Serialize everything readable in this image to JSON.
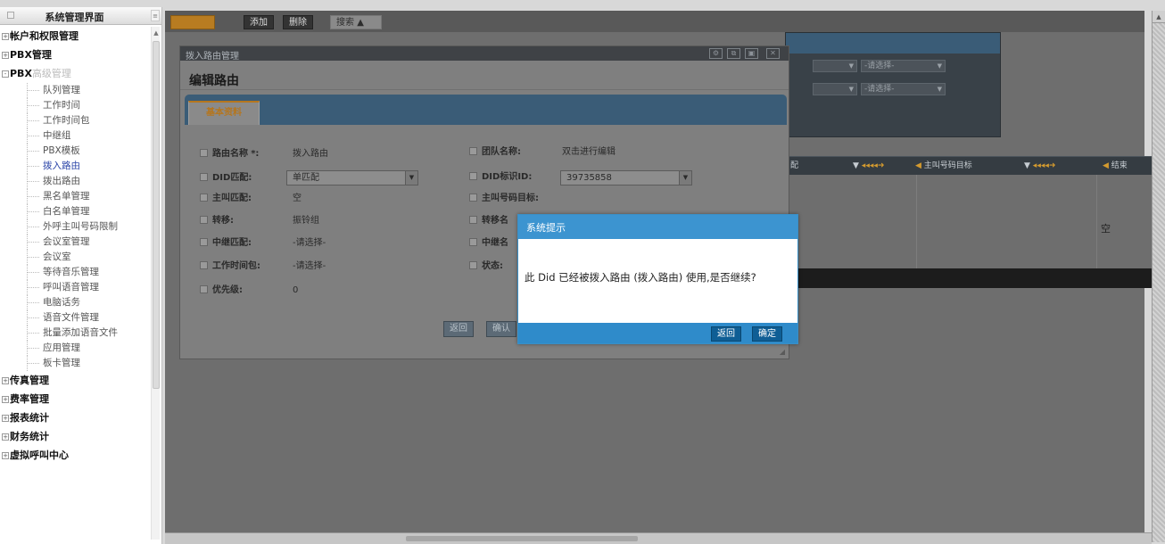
{
  "sidebar": {
    "header_title": "系统管理界面",
    "groups": [
      {
        "label": "帐户和权限管理",
        "toggle": "+"
      },
      {
        "label": "PBX管理",
        "toggle": "+"
      },
      {
        "label": "PBX",
        "label_dim": "高级管理",
        "toggle": "-"
      }
    ],
    "items": [
      "队列管理",
      "工作时间",
      "工作时间包",
      "中继组",
      "PBX模板",
      "拨入路由",
      "拨出路由",
      "黑名单管理",
      "白名单管理",
      "外呼主叫号码限制",
      "会议室管理",
      "会议室",
      "等待音乐管理",
      "呼叫语音管理",
      "电脑话务",
      "语音文件管理",
      "批量添加语音文件",
      "应用管理",
      "板卡管理"
    ],
    "active_item": "拨入路由",
    "bottom_groups": [
      {
        "label": "传真管理",
        "toggle": "+"
      },
      {
        "label": "费率管理",
        "toggle": "+"
      },
      {
        "label": "报表统计",
        "toggle": "+"
      },
      {
        "label": "财务统计",
        "toggle": "+"
      },
      {
        "label": "虚拟呼叫中心",
        "toggle": "+"
      }
    ]
  },
  "toolbar": {
    "btn1": "",
    "btn2": "添加",
    "btn3": "删除",
    "btn4": "搜索"
  },
  "background": {
    "select_placeholder_1": "-请选择-",
    "select_placeholder_2": "-请选择-",
    "col_match": "配",
    "col_caller": "主叫号码目标",
    "col_end": "结束",
    "cell_empty": "空"
  },
  "edit_window": {
    "title": "拨入路由管理",
    "heading": "编辑路由",
    "tab": "基本资料",
    "left_fields": [
      {
        "label": "路由名称",
        "required": "*:",
        "value": "拨入路由"
      },
      {
        "label": "DID匹配:",
        "value": "单匹配"
      },
      {
        "label": "主叫匹配:",
        "value": "空"
      },
      {
        "label": "转移:",
        "value": "振铃组"
      },
      {
        "label": "中继匹配:",
        "value": "-请选择-"
      },
      {
        "label": "工作时间包:",
        "value": "-请选择-"
      },
      {
        "label": "优先级:",
        "value": "0"
      }
    ],
    "right_fields": [
      {
        "label": "团队名称:",
        "value": "双击进行编辑"
      },
      {
        "label": "DID标识ID:",
        "value": "39735858"
      },
      {
        "label": "主叫号码目标:",
        "value": ""
      },
      {
        "label": "转移名",
        "value": ""
      },
      {
        "label": "中继名",
        "value": ""
      },
      {
        "label": "状态:",
        "value": ""
      }
    ],
    "btn_back": "返回",
    "btn_confirm": "确认"
  },
  "dialog": {
    "title": "系统提示",
    "message": "此 Did 已经被拨入路由 (拨入路由) 使用,是否继续?",
    "btn_back": "返回",
    "btn_ok": "确定"
  },
  "colors": {
    "accent_orange": "#b5761e",
    "dialog_blue": "#3c94d0",
    "tabbar_blue": "#3a5c77"
  }
}
